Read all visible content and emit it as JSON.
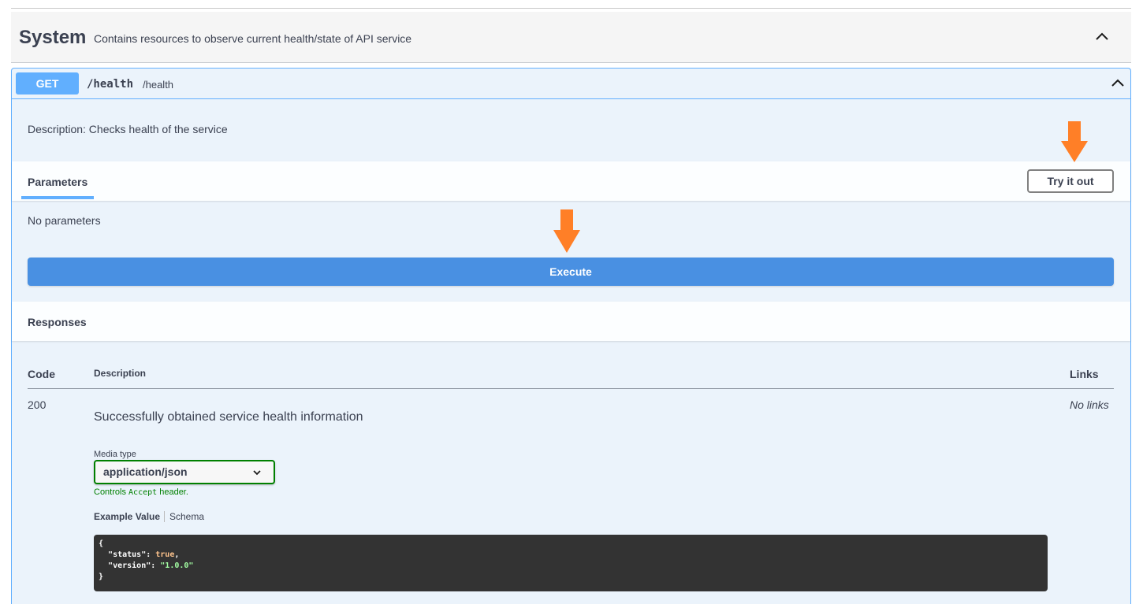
{
  "tag": {
    "name": "System",
    "description": "Contains resources to observe current health/state of API service"
  },
  "operation": {
    "method": "GET",
    "path": "/health",
    "summary": "/health",
    "description": "Description: Checks health of the service"
  },
  "parameters": {
    "title": "Parameters",
    "try_button": "Try it out",
    "empty_text": "No parameters"
  },
  "execute_button": "Execute",
  "responses": {
    "title": "Responses",
    "headers": {
      "code": "Code",
      "description": "Description",
      "links": "Links"
    },
    "rows": [
      {
        "code": "200",
        "description": "Successfully obtained service health information",
        "links": "No links",
        "media_type_label": "Media type",
        "media_type": "application/json",
        "controls_prefix": "Controls",
        "controls_code": "Accept",
        "controls_suffix": "header.",
        "example_tab": "Example Value",
        "schema_tab": "Schema",
        "example": {
          "open": "{",
          "status_key": "\"status\"",
          "status_value": "true",
          "version_key": "\"version\"",
          "version_value": "\"1.0.0\"",
          "close": "}"
        }
      }
    ]
  },
  "colors": {
    "get_method": "#61affe",
    "execute": "#4990e2",
    "annotation_arrow": "#ff7f27",
    "media_select_border": "#008000"
  }
}
